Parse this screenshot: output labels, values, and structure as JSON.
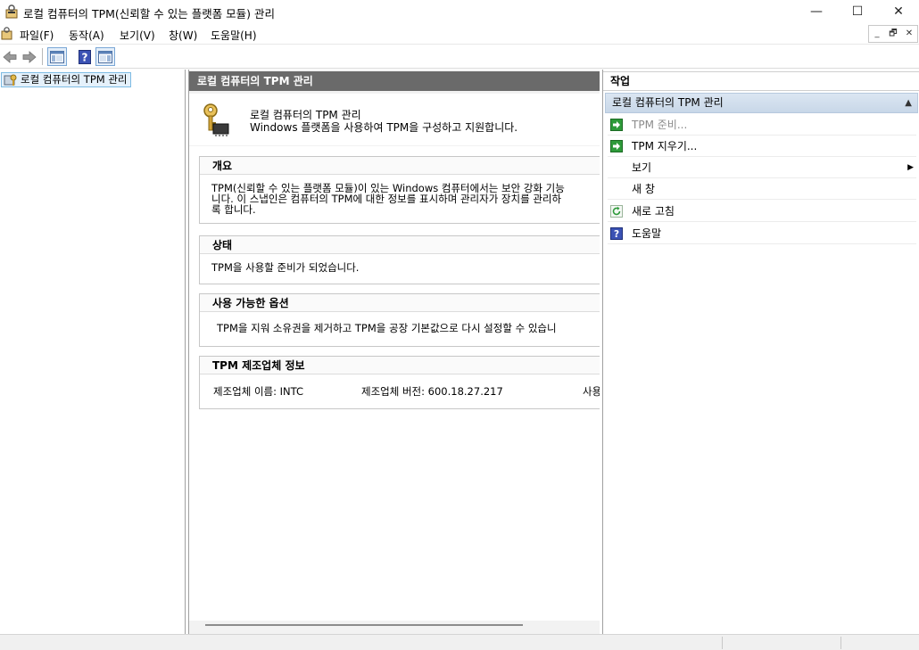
{
  "window": {
    "title": "로컬 컴퓨터의 TPM(신뢰할 수 있는 플랫폼 모듈) 관리",
    "minimize": "—",
    "maximize": "☐",
    "close": "✕"
  },
  "menu": {
    "items": [
      "파일(F)",
      "동작(A)",
      "보기(V)",
      "창(W)",
      "도움말(H)"
    ],
    "mdi_minimize": "_",
    "mdi_restore": "🗗",
    "mdi_close": "✕"
  },
  "toolbar": {
    "buttons": [
      "back-icon",
      "forward-icon",
      "show-hide-console-tree-icon",
      "help-icon",
      "show-hide-action-pane-icon"
    ]
  },
  "tree": {
    "root_label": "로컬 컴퓨터의 TPM 관리"
  },
  "center": {
    "header": "로컬 컴퓨터의 TPM 관리",
    "intro_line1": "로컬 컴퓨터의 TPM 관리",
    "intro_line2": "Windows 플랫폼을 사용하여 TPM을 구성하고 지원합니다.",
    "sections": {
      "overview": {
        "title": "개요",
        "line1": "TPM(신뢰할 수 있는 플랫폼 모듈)이 있는 Windows 컴퓨터에서는 보안 강화 기능",
        "line2": "니다. 이 스냅인은 컴퓨터의 TPM에 대한 정보를 표시하며 관리자가 장치를 관리하",
        "line3": "록 합니다."
      },
      "status": {
        "title": "상태",
        "text": "TPM을 사용할 준비가 되었습니다."
      },
      "options": {
        "title": "사용 가능한 옵션",
        "text": "TPM을 지워 소유권을 제거하고 TPM을 공장 기본값으로 다시 설정할 수 있습니"
      },
      "manufacturer": {
        "title": "TPM 제조업체 정보",
        "name": "제조업체 이름: INTC",
        "version": "제조업체 버전: 600.18.27.217",
        "cut": "사용"
      }
    }
  },
  "actions": {
    "title": "작업",
    "group": "로컬 컴퓨터의 TPM 관리",
    "items": [
      {
        "label": "TPM 준비...",
        "icon": "green-arrow-icon",
        "enabled": false
      },
      {
        "label": "TPM 지우기...",
        "icon": "green-arrow-icon",
        "enabled": true
      },
      {
        "label": "보기",
        "icon": "",
        "enabled": true
      },
      {
        "label": "새 창",
        "icon": "",
        "enabled": true
      },
      {
        "label": "새로 고침",
        "icon": "refresh-icon",
        "enabled": true
      },
      {
        "label": "도움말",
        "icon": "help-icon",
        "enabled": true
      }
    ]
  },
  "colors": {
    "header_bg": "#6a6a6a",
    "selection_bg": "#e5f1fb",
    "action_group_bg": "#d3e0ef",
    "green_icon": "#2e9a3a",
    "help_icon": "#3b52b4"
  }
}
